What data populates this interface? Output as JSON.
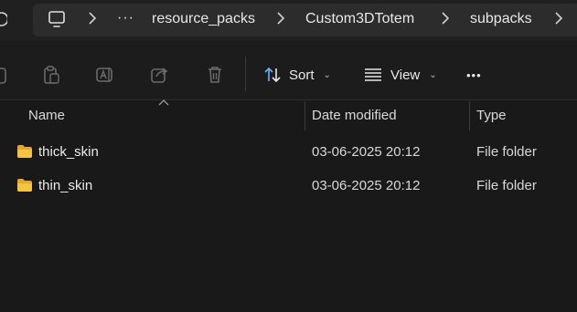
{
  "address_bar": {
    "breadcrumbs": [
      "resource_packs",
      "Custom3DTotem",
      "subpacks"
    ],
    "overflow_label": "···"
  },
  "toolbar": {
    "sort_label": "Sort",
    "view_label": "View",
    "more_label": "•••"
  },
  "columns": {
    "name": "Name",
    "date_modified": "Date modified",
    "type": "Type"
  },
  "files": [
    {
      "name": "thick_skin",
      "date_modified": "03-06-2025 20:12",
      "type": "File folder"
    },
    {
      "name": "thin_skin",
      "date_modified": "03-06-2025 20:12",
      "type": "File folder"
    }
  ],
  "colors": {
    "folder_yellow": "#f5c342",
    "background": "#191919"
  }
}
